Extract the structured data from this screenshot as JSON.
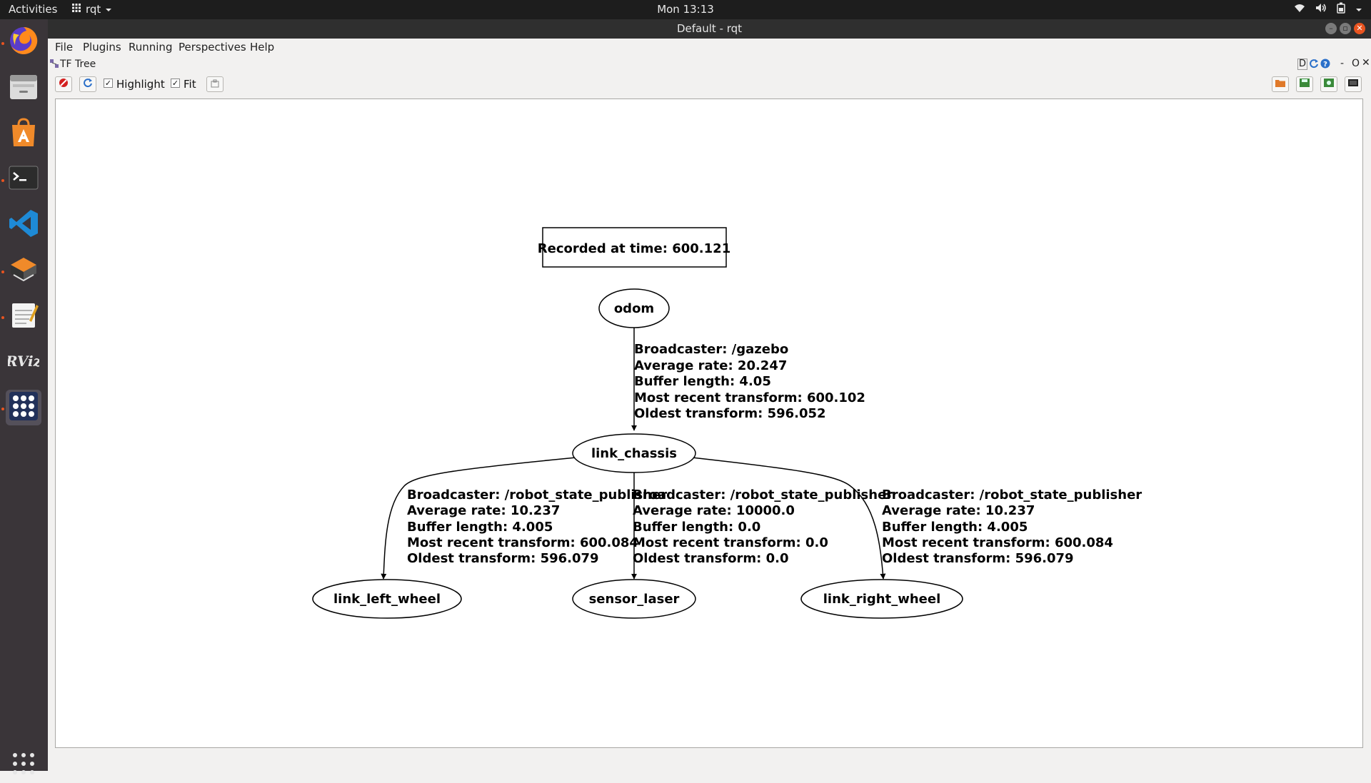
{
  "topbar": {
    "activities": "Activities",
    "app_name": "rqt",
    "clock": "Mon 13:13"
  },
  "window": {
    "title": "Default - rqt"
  },
  "menubar": {
    "items": [
      "File",
      "Plugins",
      "Running",
      "Perspectives",
      "Help"
    ]
  },
  "plugin": {
    "title": "TF Tree",
    "controls_right": [
      "D",
      "-",
      "O"
    ]
  },
  "toolbar": {
    "highlight_label": "Highlight",
    "highlight_checked": true,
    "fit_label": "Fit",
    "fit_checked": true,
    "check_mark": "✓"
  },
  "dock": {
    "items": [
      "firefox-icon",
      "files-icon",
      "software-center-icon",
      "terminal-icon",
      "vscode-icon",
      "sublime-merge-icon",
      "text-editor-icon",
      "rviz-icon",
      "rqt-icon"
    ],
    "rviz_text": "RViz"
  },
  "graph": {
    "recorded": "Recorded at time: 600.121",
    "nodes": {
      "odom": "odom",
      "link_chassis": "link_chassis",
      "link_left_wheel": "link_left_wheel",
      "sensor_laser": "sensor_laser",
      "link_right_wheel": "link_right_wheel"
    },
    "edges": {
      "odom_chassis": [
        "Broadcaster: /gazebo",
        "Average rate: 20.247",
        "Buffer length: 4.05",
        "Most recent transform: 600.102",
        "Oldest transform: 596.052"
      ],
      "chassis_left": [
        "Broadcaster: /robot_state_publisher",
        "Average rate: 10.237",
        "Buffer length: 4.005",
        "Most recent transform: 600.084",
        "Oldest transform: 596.079"
      ],
      "chassis_laser": [
        "Broadcaster: /robot_state_publisher",
        "Average rate: 10000.0",
        "Buffer length: 0.0",
        "Most recent transform: 0.0",
        "Oldest transform: 0.0"
      ],
      "chassis_right": [
        "Broadcaster: /robot_state_publisher",
        "Average rate: 10.237",
        "Buffer length: 4.005",
        "Most recent transform: 600.084",
        "Oldest transform: 596.079"
      ]
    }
  },
  "colors": {
    "accent": "#e95420",
    "dock_bg": "#3a3539",
    "topbar_bg": "#1d1d1d"
  }
}
